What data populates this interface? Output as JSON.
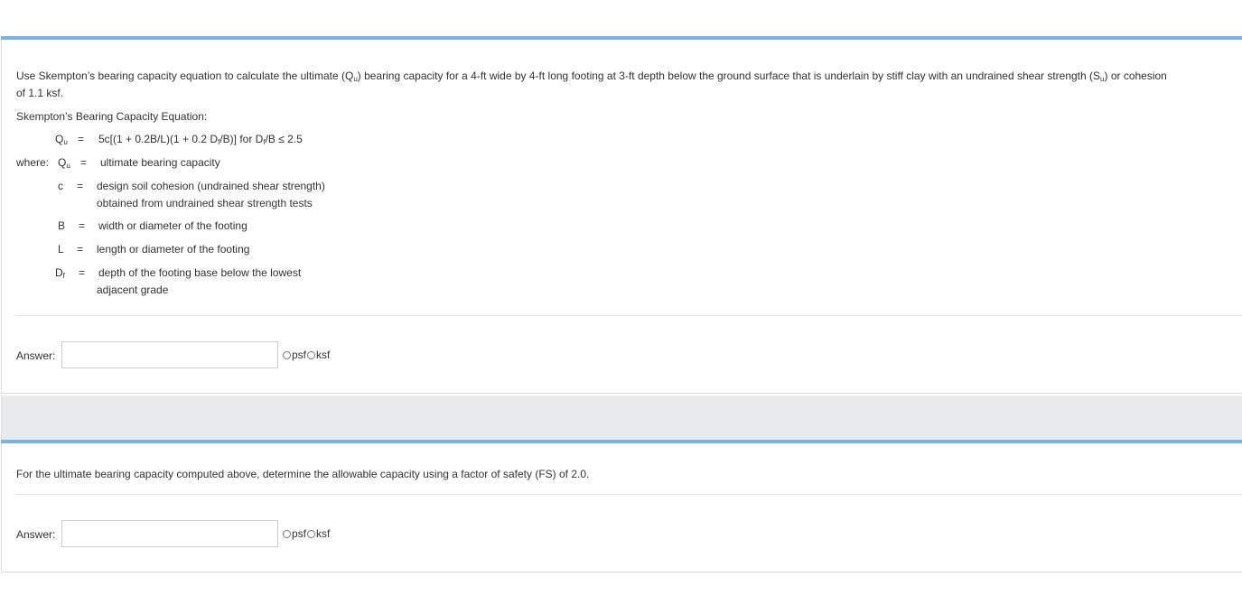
{
  "question1": {
    "prompt_line1_a": "Use Skempton’s bearing capacity equation to calculate the ultimate (Q",
    "prompt_line1_sub1": "u",
    "prompt_line1_b": ") bearing capacity for a 4-ft wide by 4-ft long footing at 3-ft depth below the ground surface that is underlain by stiff clay with an undrained shear strength (S",
    "prompt_line1_sub2": "u",
    "prompt_line1_c": ") or cohesion",
    "prompt_line2": "of 1.1 ksf.",
    "equation_heading": "Skempton’s Bearing Capacity Equation:",
    "equation": {
      "lhs": "Q",
      "lhs_sub": "u",
      "eq": "=",
      "rhs_a": "5c[(1 + 0.2B/L)(1 + 0.2 D",
      "rhs_sub1": "f",
      "rhs_b": "/B)] for D",
      "rhs_sub2": "f",
      "rhs_c": "/B ≤ 2.5"
    },
    "definitions": {
      "where_label": "where:",
      "qu_sym": "Q",
      "qu_sub": "u",
      "qu_eq": "=",
      "qu_desc": "ultimate bearing capacity",
      "c_sym": "c",
      "c_eq": "=",
      "c_desc_1": "design soil cohesion (undrained shear strength)",
      "c_desc_2": "obtained from undrained shear strength tests",
      "b_sym": "B",
      "b_eq": "=",
      "b_desc": "width or diameter of the footing",
      "l_sym": "L",
      "l_eq": "=",
      "l_desc": "length or diameter of the footing",
      "df_sym": "D",
      "df_sub": "f",
      "df_eq": "=",
      "df_desc_1": "depth of the footing base below the lowest",
      "df_desc_2": "adjacent grade"
    },
    "answer_label": "Answer:",
    "answer_value": "",
    "unit_psf": "psf",
    "unit_ksf": "ksf"
  },
  "question2": {
    "prompt": "For the ultimate bearing capacity computed above, determine the allowable capacity using a factor of safety (FS) of 2.0.",
    "answer_label": "Answer:",
    "answer_value": "",
    "unit_psf": "psf",
    "unit_ksf": "ksf"
  }
}
